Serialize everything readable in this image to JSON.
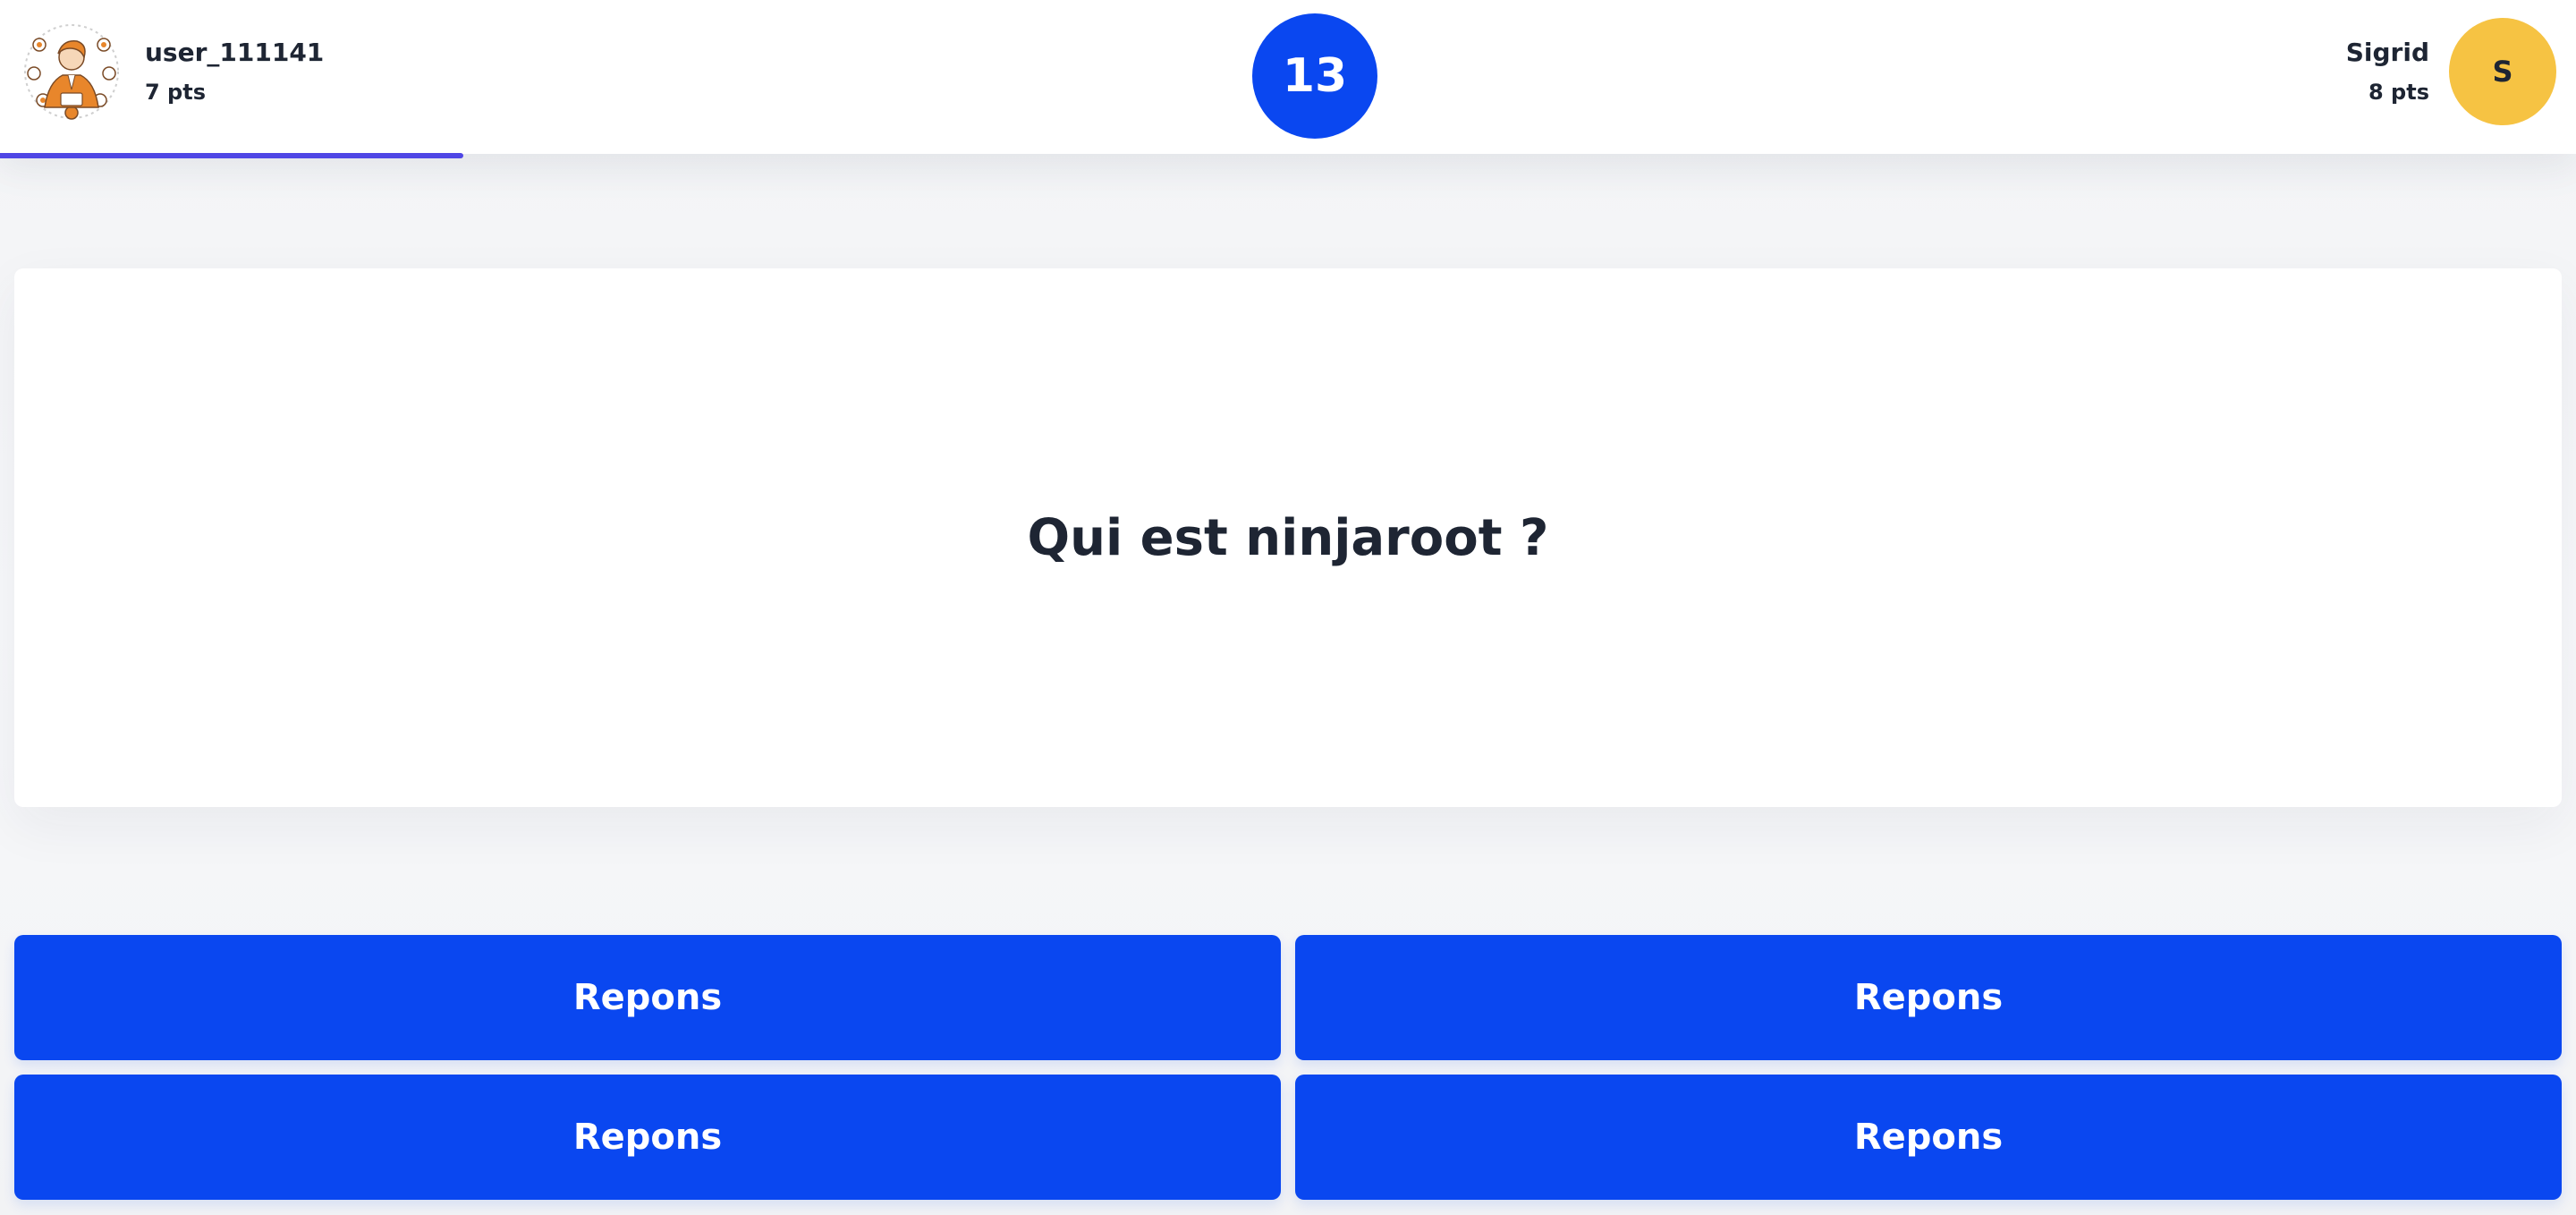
{
  "header": {
    "player_left": {
      "name": "user_111141",
      "points": "7 pts",
      "avatar_icon": "illustrated-person-avatar-icon"
    },
    "timer": {
      "value": "13"
    },
    "player_right": {
      "name": "Sigrid",
      "points": "8 pts",
      "avatar_initial": "S",
      "avatar_color": "#f6c343"
    },
    "progress": {
      "fraction": 0.18,
      "color": "#4f46e5"
    }
  },
  "question": {
    "text": "Qui est ninjaroot ?"
  },
  "answers": [
    {
      "label": "Repons"
    },
    {
      "label": "Repons"
    },
    {
      "label": "Repons"
    },
    {
      "label": "Repons"
    }
  ],
  "colors": {
    "accent": "#0a47f0",
    "text": "#1e2533",
    "background": "#f4f5f7"
  }
}
